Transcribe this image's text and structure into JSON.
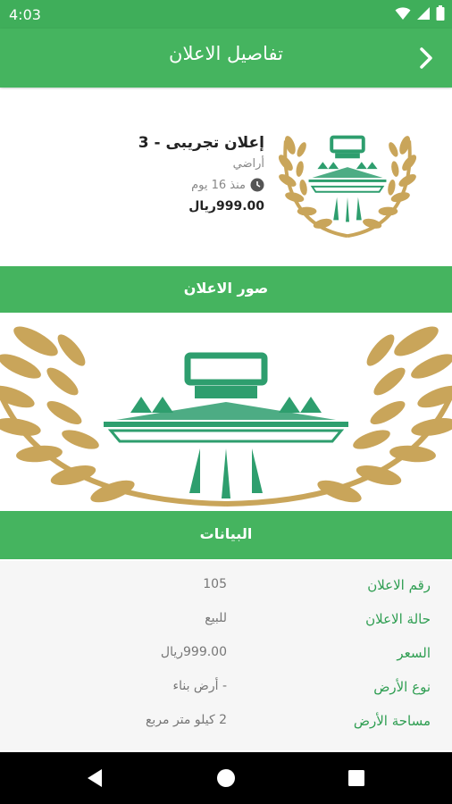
{
  "status_bar": {
    "time": "4:03"
  },
  "app_bar": {
    "title": "تفاصيل الاعلان"
  },
  "ad": {
    "title": "إعلان تجريبى - 3",
    "category": "أراضي",
    "posted": "منذ 16 يوم",
    "price": "999.00ريال"
  },
  "sections": {
    "photos": "صور الاعلان",
    "details": "البيانات"
  },
  "details": [
    {
      "label": "رقم الاعلان",
      "value": "105"
    },
    {
      "label": "حالة الاعلان",
      "value": "للبيع"
    },
    {
      "label": "السعر",
      "value": "999.00ريال"
    },
    {
      "label": "نوع الأرض",
      "value": "- أرض بناء"
    },
    {
      "label": "مساحة الأرض",
      "value": "2 كيلو متر مربع"
    }
  ],
  "colors": {
    "primary": "#45b45f",
    "status_bar": "#3fae5a",
    "logo_green": "#2e9e6e",
    "logo_gold": "#c9a55a"
  }
}
